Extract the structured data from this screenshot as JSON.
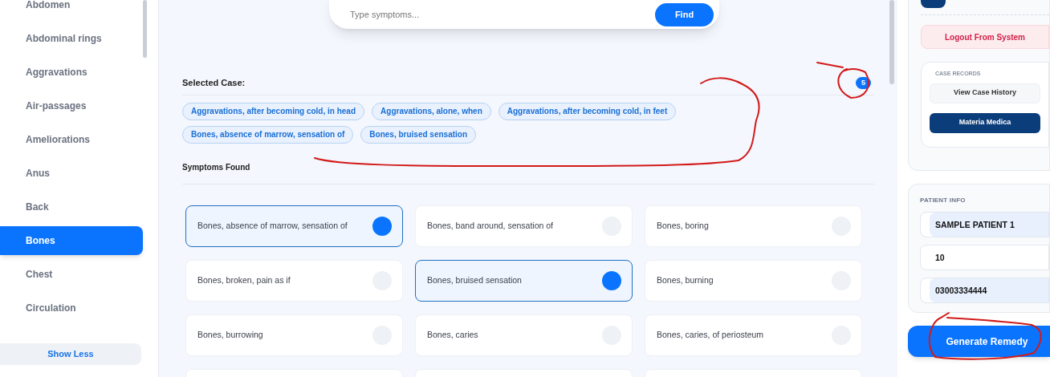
{
  "sidebar": {
    "items": [
      {
        "label": "Abdomen",
        "selected": false
      },
      {
        "label": "Abdominal rings",
        "selected": false
      },
      {
        "label": "Aggravations",
        "selected": false
      },
      {
        "label": "Air-passages",
        "selected": false
      },
      {
        "label": "Ameliorations",
        "selected": false
      },
      {
        "label": "Anus",
        "selected": false
      },
      {
        "label": "Back",
        "selected": false
      },
      {
        "label": "Bones",
        "selected": true
      },
      {
        "label": "Chest",
        "selected": false
      },
      {
        "label": "Circulation",
        "selected": false
      }
    ],
    "toggle_button": "Show Less"
  },
  "search": {
    "placeholder": "Type symptoms...",
    "button": "Find"
  },
  "selected_case": {
    "title": "Selected Case:",
    "count": "5",
    "chips": [
      "Aggravations, after becoming cold, in head",
      "Aggravations, alone, when",
      "Aggravations, after becoming cold, in feet",
      "Bones, absence of marrow, sensation of",
      "Bones, bruised sensation"
    ]
  },
  "symptoms_found": {
    "title": "Symptoms Found",
    "items": [
      {
        "label": "Bones, absence of marrow, sensation of",
        "selected": true
      },
      {
        "label": "Bones, band around, sensation of",
        "selected": false
      },
      {
        "label": "Bones, boring",
        "selected": false
      },
      {
        "label": "Bones, broken, pain as if",
        "selected": false
      },
      {
        "label": "Bones, bruised sensation",
        "selected": true
      },
      {
        "label": "Bones, burning",
        "selected": false
      },
      {
        "label": "Bones, burrowing",
        "selected": false
      },
      {
        "label": "Bones, caries",
        "selected": false
      },
      {
        "label": "Bones, caries, of periosteum",
        "selected": false
      }
    ]
  },
  "account": {
    "logout_button": "Logout From System",
    "case_records": {
      "title": "CASE RECORDS",
      "buttons": [
        {
          "label": "View Case History",
          "kind": "secondary"
        },
        {
          "label": "Materia Medica",
          "kind": "primary"
        }
      ]
    }
  },
  "patient_info": {
    "title": "PATIENT INFO",
    "fields": [
      {
        "value": "SAMPLE PATIENT 1",
        "autofilled": true
      },
      {
        "value": "10",
        "autofilled": false
      },
      {
        "value": "03003334444",
        "autofilled": true
      }
    ]
  },
  "generate_button": "Generate Remedy"
}
